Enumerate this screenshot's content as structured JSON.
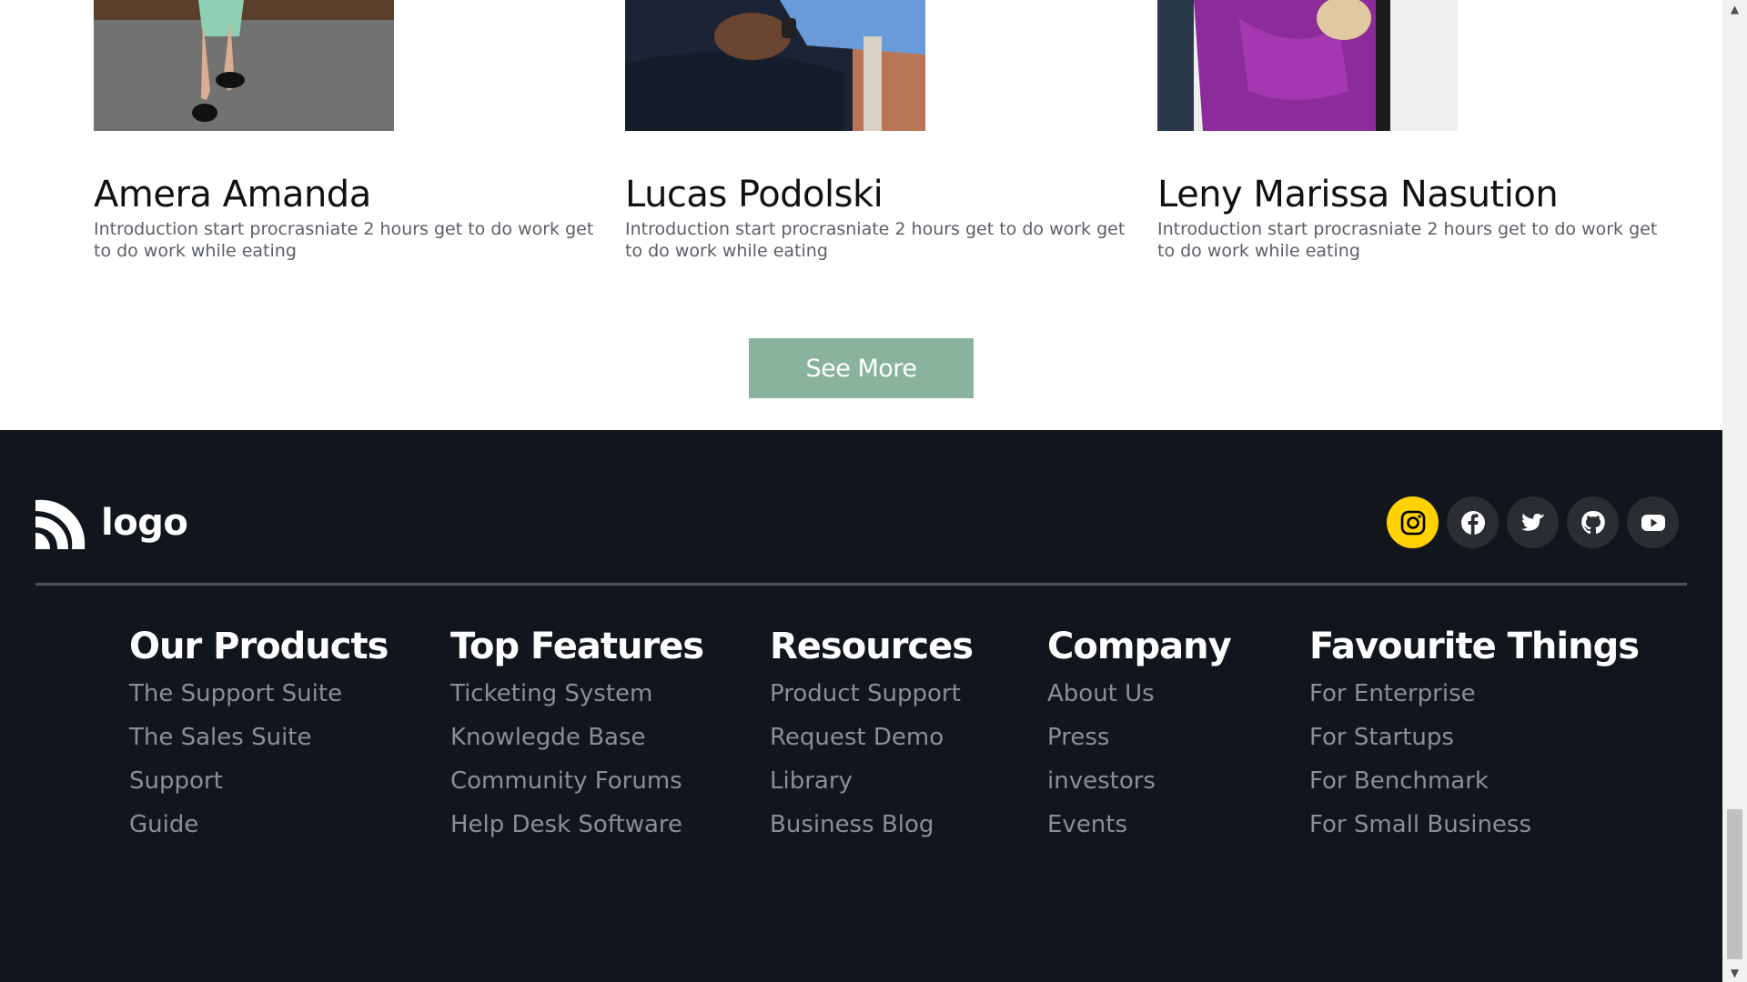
{
  "team": {
    "members": [
      {
        "name": "Amera Amanda",
        "bio": "Introduction start procrasniate 2 hours get to do work get to do work while eating"
      },
      {
        "name": "Lucas Podolski",
        "bio": "Introduction start procrasniate 2 hours get to do work get to do work while eating"
      },
      {
        "name": "Leny Marissa Nasution",
        "bio": "Introduction start procrasniate 2 hours get to do work get to do work while eating"
      }
    ],
    "see_more_label": "See More"
  },
  "footer": {
    "logo_text": "logo",
    "socials": [
      {
        "icon": "instagram-icon",
        "active": true
      },
      {
        "icon": "facebook-icon",
        "active": false
      },
      {
        "icon": "twitter-icon",
        "active": false
      },
      {
        "icon": "github-icon",
        "active": false
      },
      {
        "icon": "youtube-icon",
        "active": false
      }
    ],
    "columns": [
      {
        "title": "Our Products",
        "links": [
          "The Support Suite",
          "The Sales Suite",
          "Support",
          "Guide"
        ]
      },
      {
        "title": "Top Features",
        "links": [
          "Ticketing System",
          "Knowlegde Base",
          "Community Forums",
          "Help Desk Software"
        ]
      },
      {
        "title": "Resources",
        "links": [
          "Product Support",
          "Request Demo",
          "Library",
          "Business Blog"
        ]
      },
      {
        "title": "Company",
        "links": [
          "About Us",
          "Press",
          "investors",
          "Events"
        ]
      },
      {
        "title": "Favourite Things",
        "links": [
          "For Enterprise",
          "For Startups",
          "For Benchmark",
          "For Small Business"
        ]
      }
    ]
  },
  "colors": {
    "accent_button": "#8ab39d",
    "footer_bg": "#11161c",
    "social_active": "#ffd200"
  }
}
